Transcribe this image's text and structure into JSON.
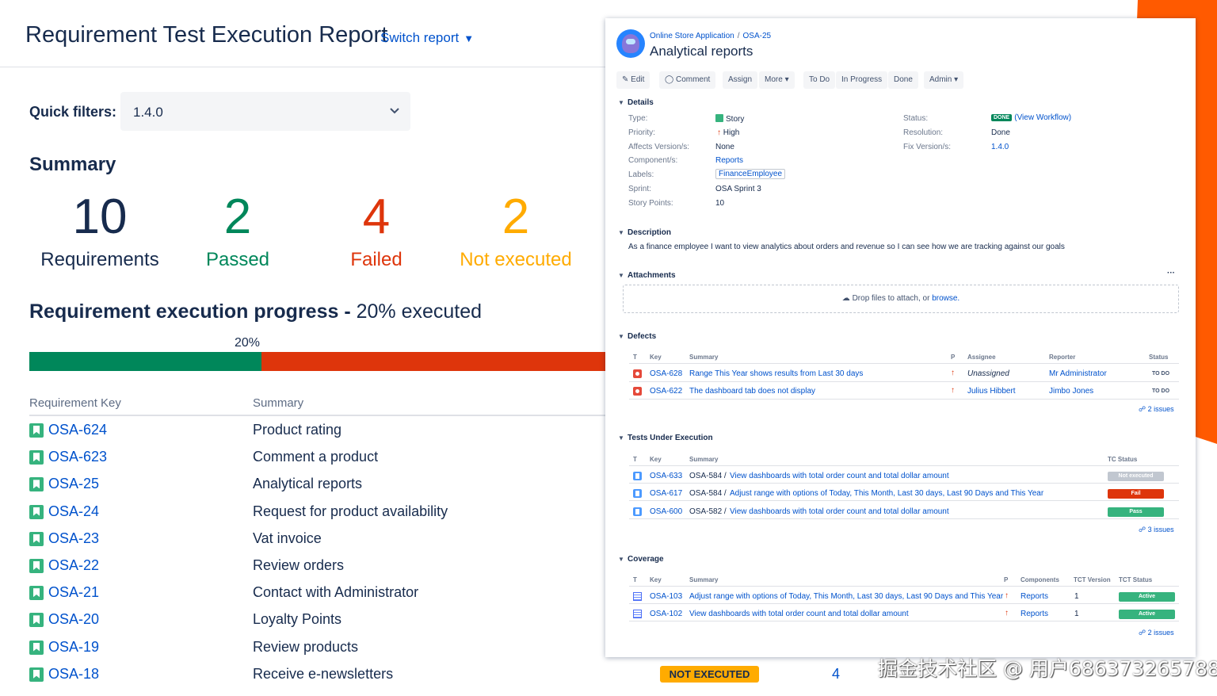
{
  "report": {
    "title": "Requirement Test Execution Report",
    "switch_label": "Switch report",
    "quick_filters_label": "Quick filters:",
    "quick_filter_value": "1.4.0",
    "summary_title": "Summary",
    "stats": [
      {
        "value": "10",
        "label": "Requirements"
      },
      {
        "value": "2",
        "label": "Passed"
      },
      {
        "value": "4",
        "label": "Failed"
      },
      {
        "value": "2",
        "label": "Not executed"
      }
    ],
    "progress_title": "Requirement execution progress",
    "progress_sep": " - ",
    "progress_suffix": "20% executed",
    "progress_pct_label": "20%",
    "progress_fraction": 0.4,
    "col_key": "Requirement Key",
    "col_summary": "Summary",
    "rows": [
      {
        "key": "OSA-624",
        "summary": "Product rating"
      },
      {
        "key": "OSA-623",
        "summary": "Comment a product"
      },
      {
        "key": "OSA-25",
        "summary": "Analytical reports"
      },
      {
        "key": "OSA-24",
        "summary": "Request for product availability"
      },
      {
        "key": "OSA-23",
        "summary": "Vat invoice"
      },
      {
        "key": "OSA-22",
        "summary": "Review orders"
      },
      {
        "key": "OSA-21",
        "summary": "Contact with Administrator"
      },
      {
        "key": "OSA-20",
        "summary": "Loyalty Points"
      },
      {
        "key": "OSA-19",
        "summary": "Review products"
      },
      {
        "key": "OSA-18",
        "summary": "Receive e-newsletters"
      }
    ],
    "bottom_status": "NOT EXECUTED",
    "bottom_count": "4"
  },
  "watermark": "掘金技术社区 @ 用户686373265788",
  "issue": {
    "project": "Online Store Application",
    "sep": "/",
    "key": "OSA-25",
    "title": "Analytical reports",
    "toolbar": [
      "Edit",
      "Comment",
      "Assign",
      "More",
      "To Do",
      "In Progress",
      "Done",
      "Admin"
    ],
    "details_label": "Details",
    "type_label": "Type:",
    "type_value": "Story",
    "priority_label": "Priority:",
    "priority_value": "High",
    "affects_label": "Affects Version/s:",
    "affects_value": "None",
    "component_label": "Component/s:",
    "component_value": "Reports",
    "labels_label": "Labels:",
    "labels_value": "FinanceEmployee",
    "sprint_label": "Sprint:",
    "sprint_value": "OSA Sprint 3",
    "points_label": "Story Points:",
    "points_value": "10",
    "status_label": "Status:",
    "status_lozenge": "DONE",
    "status_link": "(View Workflow)",
    "resolution_label": "Resolution:",
    "resolution_value": "Done",
    "fix_label": "Fix Version/s:",
    "fix_value": "1.4.0",
    "description_label": "Description",
    "description_text": "As a finance employee I want to view analytics about orders and revenue so I can see how we are tracking against our goals",
    "attachments_label": "Attachments",
    "attachments_more": "···",
    "drop_text": "Drop files to attach, or",
    "drop_link": "browse.",
    "defects_label": "Defects",
    "defects_cols": [
      "T",
      "Key",
      "Summary",
      "P",
      "Assignee",
      "Reporter",
      "Status"
    ],
    "defects": [
      {
        "key": "OSA-628",
        "summary": "Range This Year shows results from Last 30 days",
        "assignee": "Unassigned",
        "reporter": "Mr Administrator",
        "status": "TO DO"
      },
      {
        "key": "OSA-622",
        "summary": "The dashboard tab does not display",
        "assignee": "Julius Hibbert",
        "reporter": "Jimbo Jones",
        "status": "TO DO"
      }
    ],
    "defects_count": "2 issues",
    "tests_label": "Tests Under Execution",
    "tests_cols": [
      "T",
      "Key",
      "Summary",
      "TC Status"
    ],
    "tests": [
      {
        "key": "OSA-633",
        "parent": "OSA-584 /",
        "summary": "View dashboards with total order count and total dollar amount",
        "status": "Not executed",
        "color": "#c1c7d0"
      },
      {
        "key": "OSA-617",
        "parent": "OSA-584 /",
        "summary": "Adjust range with options of Today, This Month, Last 30 days, Last 90 Days and This Year",
        "status": "Fail",
        "color": "#de350b"
      },
      {
        "key": "OSA-600",
        "parent": "OSA-582 /",
        "summary": "View dashboards with total order count and total dollar amount",
        "status": "Pass",
        "color": "#36b37e"
      }
    ],
    "tests_count": "3 issues",
    "coverage_label": "Coverage",
    "coverage_cols": [
      "T",
      "Key",
      "Summary",
      "P",
      "Components",
      "TCT Version",
      "TCT Status"
    ],
    "coverage": [
      {
        "key": "OSA-103",
        "summary": "Adjust range with options of Today, This Month, Last 30 days, Last 90 Days and This Year",
        "component": "Reports",
        "version": "1",
        "status": "Active"
      },
      {
        "key": "OSA-102",
        "summary": "View dashboards with total order count and total dollar amount",
        "component": "Reports",
        "version": "1",
        "status": "Active"
      }
    ],
    "coverage_count": "2 issues"
  },
  "colors": {
    "passed": "#00875a",
    "failed": "#de350b",
    "not_executed": "#ffab00",
    "link": "#0052cc",
    "accent_orange": "#ff5a00"
  }
}
